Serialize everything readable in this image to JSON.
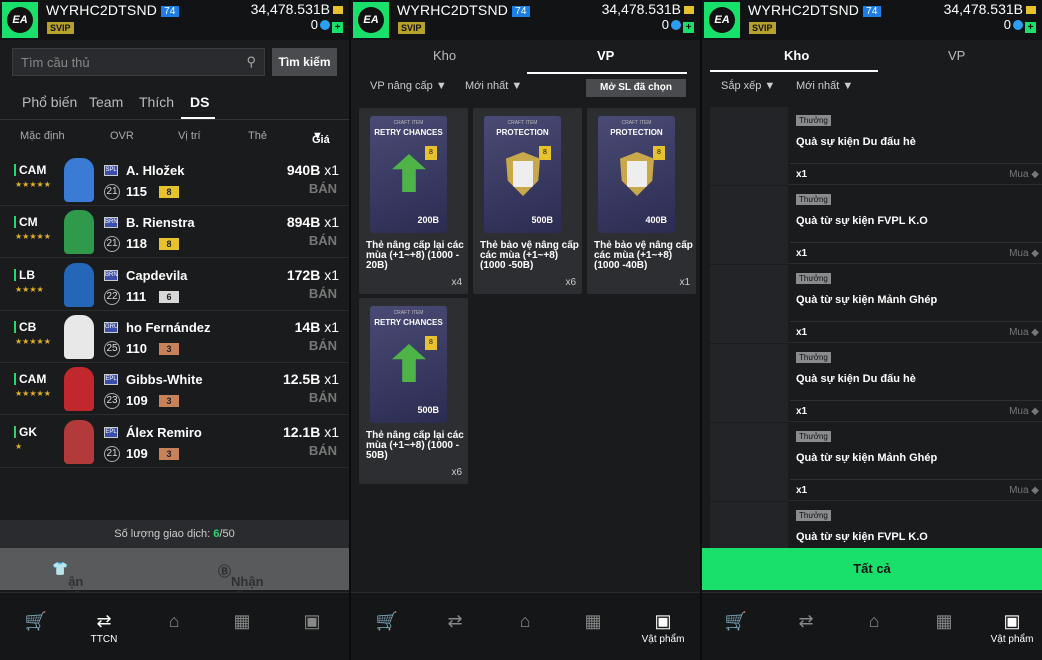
{
  "header": {
    "username": "WYRHC2DTSND",
    "level": "74",
    "vip": "SVIP",
    "balance": "34,478.531B",
    "points": "0"
  },
  "market": {
    "search_placeholder": "Tìm cầu thủ",
    "search_button": "Tìm kiếm",
    "filter_tabs": [
      "Phổ biến",
      "Team",
      "Thích",
      "DS"
    ],
    "sort_labels": [
      "Mặc định",
      "OVR",
      "Vị trí",
      "Thẻ",
      "Giá"
    ],
    "players": [
      {
        "pos": "CAM",
        "stars": "★★★★★",
        "club": "SPL",
        "name": "A. Hložek",
        "rank": "21",
        "ovr": "115",
        "upg": "8",
        "upg_color": "#e8c22c",
        "price": "940B",
        "qty": "x1",
        "action": "BÁN",
        "face": "#3a7bd5"
      },
      {
        "pos": "CM",
        "stars": "★★★★★",
        "club": "BRN",
        "name": "B. Rienstra",
        "rank": "21",
        "ovr": "118",
        "upg": "8",
        "upg_color": "#e8c22c",
        "price": "894B",
        "qty": "x1",
        "action": "BÁN",
        "face": "#2f9a4c"
      },
      {
        "pos": "LB",
        "stars": "★★★★",
        "club": "BRN",
        "name": "Capdevila",
        "rank": "22",
        "ovr": "111",
        "upg": "6",
        "upg_color": "#d8d8d8",
        "price": "172B",
        "qty": "x1",
        "action": "BÁN",
        "face": "#2466b8"
      },
      {
        "pos": "CB",
        "stars": "★★★★★",
        "club": "GRU",
        "name": "ho Fernández",
        "rank": "25",
        "ovr": "110",
        "upg": "3",
        "upg_color": "#c8825a",
        "price": "14B",
        "qty": "x1",
        "action": "BÁN",
        "face": "#e8e8e8"
      },
      {
        "pos": "CAM",
        "stars": "★★★★★",
        "club": "EPL",
        "name": "Gibbs-White",
        "rank": "23",
        "ovr": "109",
        "upg": "3",
        "upg_color": "#c8825a",
        "price": "12.5B",
        "qty": "x1",
        "action": "BÁN",
        "face": "#c0282d"
      },
      {
        "pos": "GK",
        "stars": "★",
        "club": "EPL",
        "name": "Álex Remiro",
        "rank": "21",
        "ovr": "109",
        "upg": "3",
        "upg_color": "#c8825a",
        "price": "12.1B",
        "qty": "x1",
        "action": "BÁN",
        "face": "#b23a3a"
      }
    ],
    "trades_label": "Số lượng giao dịch:",
    "trades_used": "6",
    "trades_total": "/50",
    "receive_left": "ận tất cả",
    "receive_right": "Nhận tất cả"
  },
  "nav": {
    "ttcn": "TTCN",
    "items": "Vật phẩm"
  },
  "vp": {
    "tabs": [
      "Kho",
      "VP"
    ],
    "filter1": "VP nâng cấp ▼",
    "filter2": "Mới nhất ▼",
    "open_btn": "Mở SL đã chọn",
    "cards": [
      {
        "craft": "CRAFT ITEM",
        "title": "RETRY CHANCES",
        "chip": "8",
        "value": "200B",
        "name": "Thẻ nâng cấp lại các mùa (+1~+8) (1000 - 20B)",
        "qty": "x4",
        "kind": "retry"
      },
      {
        "craft": "CRAFT ITEM",
        "title": "PROTECTION",
        "chip": "8",
        "value": "500B",
        "name": "Thẻ bảo vệ nâng cấp các mùa (+1~+8) (1000 -50B)",
        "qty": "x6",
        "kind": "protect"
      },
      {
        "craft": "CRAFT ITEM",
        "title": "PROTECTION",
        "chip": "8",
        "value": "400B",
        "name": "Thẻ bảo vệ nâng cấp các mùa (+1~+8) (1000 -40B)",
        "qty": "x1",
        "kind": "protect"
      },
      {
        "craft": "CRAFT ITEM",
        "title": "RETRY CHANCES",
        "chip": "8",
        "value": "500B",
        "name": "Thẻ nâng cấp lại các mùa (+1~+8) (1000 - 50B)",
        "qty": "x6",
        "kind": "retry"
      }
    ]
  },
  "kho": {
    "tabs": [
      "Kho",
      "VP"
    ],
    "sort": "Sắp xếp ▼",
    "filter": "Mới nhất ▼",
    "items": [
      {
        "tag": "Thưởng",
        "title": "Quà sự kiện Du đấu hè",
        "qty": "x1",
        "buy": "Mua"
      },
      {
        "tag": "Thưởng",
        "title": "Quà từ sự kiện FVPL K.O",
        "qty": "x1",
        "buy": "Mua"
      },
      {
        "tag": "Thưởng",
        "title": "Quà từ sự kiện Mảnh Ghép",
        "qty": "x1",
        "buy": "Mua"
      },
      {
        "tag": "Thưởng",
        "title": "Quà sự kiện Du đấu hè",
        "qty": "x1",
        "buy": "Mua"
      },
      {
        "tag": "Thưởng",
        "title": "Quà từ sự kiện Mảnh Ghép",
        "qty": "x1",
        "buy": "Mua"
      },
      {
        "tag": "Thưởng",
        "title": "Quà từ sự kiện FVPL K.O",
        "qty": "x1",
        "buy": "Mua"
      }
    ],
    "all_button": "Tất cả"
  }
}
